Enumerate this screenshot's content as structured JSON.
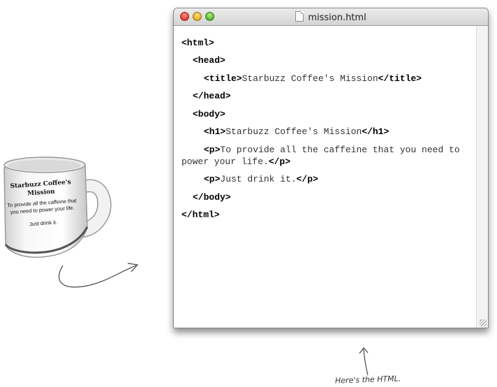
{
  "window": {
    "title": "mission.html",
    "code": {
      "l1_tag": "<html>",
      "l2_tag": "<head>",
      "l3_open": "<title>",
      "l3_text": "Starbuzz Coffee's Mission",
      "l3_close": "</title>",
      "l4_tag": "</head>",
      "l5_tag": "<body>",
      "l6_open": "<h1>",
      "l6_text": "Starbuzz Coffee's Mission",
      "l6_close": "</h1>",
      "l7_open": "<p>",
      "l7_text": "To provide all the caffeine that you need to",
      "l8_text": "power your life.",
      "l8_close": "</p>",
      "l9_open": "<p>",
      "l9_text": "Just drink it.",
      "l9_close": "</p>",
      "l10_tag": "</body>",
      "l11_tag": "</html>"
    }
  },
  "mug": {
    "title": "Starbuzz Coffee's Mission",
    "body": "To provide all the caffeine that you need to power your life.",
    "sign": "Just drink it."
  },
  "annotation": "Here's the HTML."
}
